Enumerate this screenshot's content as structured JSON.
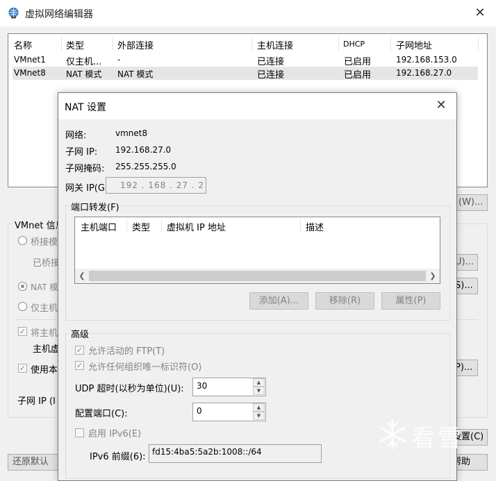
{
  "main_window": {
    "title": "虚拟网络编辑器",
    "close_glyph": "✕",
    "columns": [
      "名称",
      "类型",
      "外部连接",
      "主机连接",
      "DHCP",
      "子网地址"
    ],
    "rows": [
      {
        "name": "VMnet1",
        "type": "仅主机...",
        "external": "-",
        "host": "已连接",
        "dhcp": "已启用",
        "subnet": "192.168.153.0"
      },
      {
        "name": "VMnet8",
        "type": "NAT 模式",
        "external": "NAT 模式",
        "host": "已连接",
        "dhcp": "已启用",
        "subnet": "192.168.27.0"
      }
    ],
    "background": {
      "rename_button": "名(W)...",
      "vmnet_info": "VMnet 信息",
      "bridge_radio": "桥接模",
      "bridged_to": "已桥接",
      "auto_button": "U)...",
      "nat_radio": "NAT 模",
      "nat_settings_button": "S)...",
      "host_only_radio": "仅主机",
      "connect_host_check": "将主机",
      "host_adapter": "主机虚",
      "use_dhcp_check": "使用本",
      "dhcp_settings_button": "P)...",
      "subnet_ip": "子网 IP (I",
      "change_settings_button": "设置(C)",
      "restore_defaults_button": "还原默认",
      "help_button": "帮助"
    }
  },
  "nat_dialog": {
    "title": "NAT 设置",
    "close_glyph": "✕",
    "network_label": "网络:",
    "network_value": "vmnet8",
    "subnet_ip_label": "子网 IP:",
    "subnet_ip_value": "192.168.27.0",
    "subnet_mask_label": "子网掩码:",
    "subnet_mask_value": "255.255.255.0",
    "gateway_label": "网关 IP(G):",
    "gateway_value": "192 . 168 . 27 . 2",
    "port_forwarding": {
      "title": "端口转发(F)",
      "columns": [
        "主机端口",
        "类型",
        "虚拟机 IP 地址",
        "描述"
      ],
      "add_button": "添加(A)...",
      "remove_button": "移除(R)",
      "properties_button": "属性(P)"
    },
    "advanced": {
      "title": "高级",
      "allow_ftp": "允许活动的 FTP(T)",
      "allow_ouid": "允许任何组织唯一标识符(O)",
      "udp_timeout_label": "UDP 超时(以秒为单位)(U):",
      "udp_timeout_value": "30",
      "config_port_label": "配置端口(C):",
      "config_port_value": "0",
      "enable_ipv6": "启用 IPv6(E)",
      "ipv6_prefix_label": "IPv6 前缀(6):",
      "ipv6_prefix_value": "fd15:4ba5:5a2b:1008::/64"
    }
  },
  "watermark": "看雪",
  "colors": {
    "title_bar": "#ffffff",
    "window_bg": "#f0f0f0",
    "selection": "#e5e5e5",
    "disabled_text": "#838383"
  }
}
